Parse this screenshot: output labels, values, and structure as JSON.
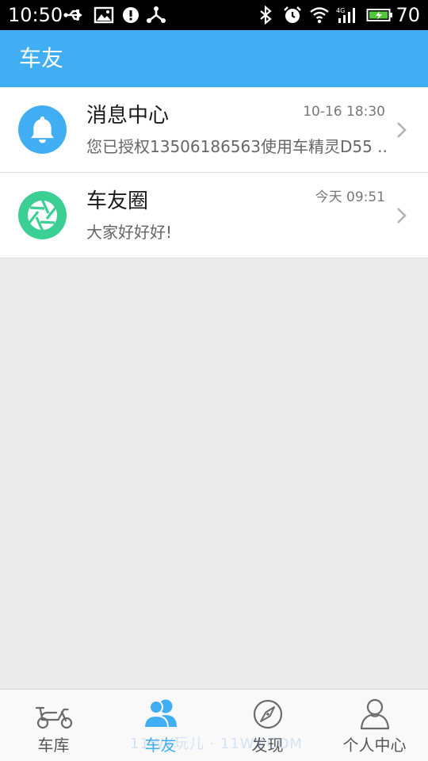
{
  "status_bar": {
    "time": "10:50",
    "battery_level": "70",
    "icons": [
      "usb-icon",
      "image-icon",
      "alert-icon",
      "share-icon",
      "bluetooth-icon",
      "alarm-icon",
      "wifi-icon",
      "signal-4g-icon",
      "battery-charging-icon"
    ]
  },
  "header": {
    "title": "车友"
  },
  "conversations": [
    {
      "title": "消息中心",
      "time": "10-16 18:30",
      "preview": "您已授权13506186563使用车精灵D55 ..",
      "icon": "bell-icon",
      "color": "#41aef4"
    },
    {
      "title": "车友圈",
      "time": "今天 09:51",
      "preview": "大家好好好!",
      "icon": "aperture-icon",
      "color": "#3ccf93"
    }
  ],
  "tabs": [
    {
      "label": "车库",
      "icon": "scooter-icon",
      "active": false
    },
    {
      "label": "车友",
      "icon": "friends-icon",
      "active": true
    },
    {
      "label": "发现",
      "icon": "compass-icon",
      "active": false
    },
    {
      "label": "个人中心",
      "icon": "person-icon",
      "active": false
    }
  ],
  "watermark": "11WY玩儿 · 11WY.COM",
  "colors": {
    "accent": "#41aef4",
    "green": "#3ccf93",
    "background": "#ebebeb"
  }
}
